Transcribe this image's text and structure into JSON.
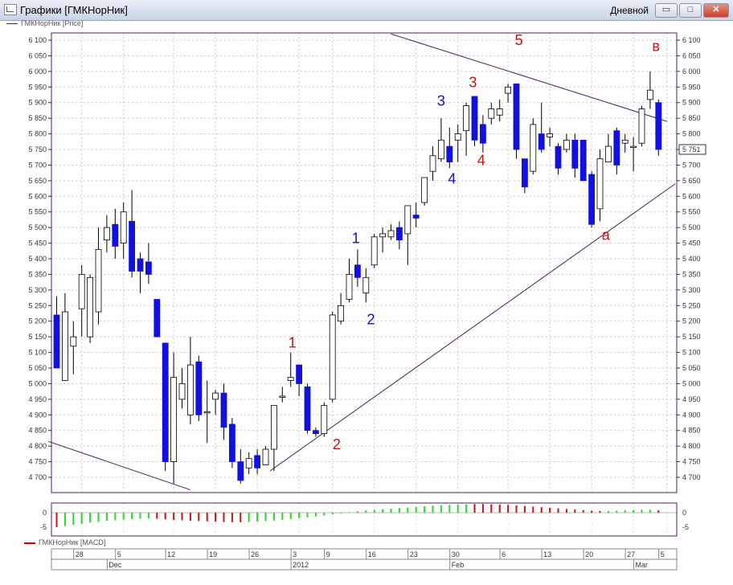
{
  "window": {
    "title": "Графики [ГМКНорНик]",
    "period": "Дневной",
    "buttons": {
      "minimize": "▭",
      "maximize": "□",
      "close": "✕"
    }
  },
  "price_legend": "ГМКНорНик [Price]",
  "macd_legend": "ГМКНорНик [MACD]",
  "last_price": "5 751",
  "colors": {
    "up": "#ffffff",
    "down": "#1010e0",
    "wick": "#000000",
    "trendline": "#4d1f5e",
    "macd_pos": "#22dd22",
    "macd_neg": "#cc1111"
  },
  "chart_data": {
    "type": "candlestick",
    "ylim": [
      4650,
      6125
    ],
    "y_ticks": [
      "4 700",
      "4 750",
      "4 800",
      "4 850",
      "4 900",
      "4 950",
      "5 000",
      "5 050",
      "5 100",
      "5 150",
      "5 200",
      "5 250",
      "5 300",
      "5 350",
      "5 400",
      "5 450",
      "5 500",
      "5 550",
      "5 600",
      "5 650",
      "5 700",
      "5 750",
      "5 800",
      "5 850",
      "5 900",
      "5 950",
      "6 000",
      "6 050",
      "6 100"
    ],
    "candles": [
      [
        5220,
        5050,
        5280,
        5050
      ],
      [
        5010,
        5230,
        5290,
        5010
      ],
      [
        5120,
        5150,
        5200,
        5030
      ],
      [
        5240,
        5350,
        5380,
        5150
      ],
      [
        5150,
        5340,
        5350,
        5130
      ],
      [
        5230,
        5430,
        5500,
        5190
      ],
      [
        5460,
        5500,
        5540,
        5420
      ],
      [
        5510,
        5440,
        5560,
        5400
      ],
      [
        5450,
        5550,
        5580,
        5400
      ],
      [
        5520,
        5360,
        5620,
        5340
      ],
      [
        5400,
        5360,
        5420,
        5290
      ],
      [
        5390,
        5350,
        5450,
        5320
      ],
      [
        5270,
        5150,
        5270,
        5150
      ],
      [
        5130,
        4750,
        5130,
        4720
      ],
      [
        4750,
        5020,
        5100,
        4680
      ],
      [
        4950,
        5000,
        5050,
        4920
      ],
      [
        4900,
        5060,
        5150,
        4870
      ],
      [
        5070,
        4900,
        5090,
        4880
      ],
      [
        4910,
        4910,
        5010,
        4810
      ],
      [
        4950,
        4970,
        4980,
        4900
      ],
      [
        4970,
        4860,
        5000,
        4820
      ],
      [
        4870,
        4750,
        4890,
        4730
      ],
      [
        4750,
        4690,
        4790,
        4680
      ],
      [
        4730,
        4760,
        4780,
        4710
      ],
      [
        4770,
        4730,
        4790,
        4710
      ],
      [
        4740,
        4790,
        4800,
        4740
      ],
      [
        4790,
        4930,
        4930,
        4720
      ],
      [
        4960,
        4960,
        4990,
        4940
      ],
      [
        5010,
        5020,
        5100,
        4990
      ],
      [
        5060,
        5000,
        5060,
        4960
      ],
      [
        4990,
        4850,
        5000,
        4840
      ],
      [
        4850,
        4840,
        4860,
        4830
      ],
      [
        4840,
        4930,
        4940,
        4830
      ],
      [
        4950,
        5220,
        5230,
        4940
      ],
      [
        5200,
        5250,
        5290,
        5190
      ],
      [
        5270,
        5350,
        5400,
        5260
      ],
      [
        5380,
        5340,
        5430,
        5310
      ],
      [
        5290,
        5340,
        5370,
        5260
      ],
      [
        5380,
        5470,
        5480,
        5370
      ],
      [
        5470,
        5480,
        5500,
        5420
      ],
      [
        5470,
        5490,
        5510,
        5460
      ],
      [
        5500,
        5460,
        5520,
        5430
      ],
      [
        5480,
        5570,
        5570,
        5380
      ],
      [
        5540,
        5530,
        5580,
        5500
      ],
      [
        5580,
        5660,
        5660,
        5570
      ],
      [
        5680,
        5730,
        5760,
        5650
      ],
      [
        5720,
        5780,
        5850,
        5710
      ],
      [
        5760,
        5710,
        5820,
        5690
      ],
      [
        5780,
        5800,
        5830,
        5710
      ],
      [
        5810,
        5890,
        5900,
        5730
      ],
      [
        5920,
        5780,
        5920,
        5760
      ],
      [
        5830,
        5770,
        5860,
        5740
      ],
      [
        5850,
        5880,
        5900,
        5830
      ],
      [
        5860,
        5880,
        5910,
        5840
      ],
      [
        5930,
        5950,
        5960,
        5900
      ],
      [
        5960,
        5750,
        5960,
        5720
      ],
      [
        5720,
        5630,
        5720,
        5610
      ],
      [
        5680,
        5830,
        5850,
        5670
      ],
      [
        5800,
        5750,
        5900,
        5740
      ],
      [
        5790,
        5800,
        5820,
        5760
      ],
      [
        5760,
        5690,
        5770,
        5670
      ],
      [
        5750,
        5780,
        5800,
        5740
      ],
      [
        5780,
        5690,
        5800,
        5660
      ],
      [
        5780,
        5650,
        5780,
        5650
      ],
      [
        5670,
        5510,
        5680,
        5500
      ],
      [
        5560,
        5720,
        5750,
        5520
      ],
      [
        5710,
        5760,
        5800,
        5710
      ],
      [
        5810,
        5700,
        5820,
        5670
      ],
      [
        5770,
        5780,
        5800,
        5740
      ],
      [
        5760,
        5760,
        5790,
        5680
      ],
      [
        5770,
        5880,
        5890,
        5760
      ],
      [
        5910,
        5940,
        6000,
        5880
      ],
      [
        5900,
        5750,
        5910,
        5730
      ]
    ],
    "x_ticks": [
      "28",
      "5",
      "12",
      "19",
      "26",
      "3",
      "9",
      "16",
      "23",
      "30",
      "6",
      "13",
      "20",
      "27",
      "5"
    ],
    "x_tick_index": [
      3,
      8,
      14,
      19,
      24,
      29,
      33,
      38,
      43,
      48,
      54,
      59,
      64,
      69,
      73
    ],
    "months": [
      {
        "label": "Dec",
        "index": 7
      },
      {
        "label": "2012",
        "index": 29
      },
      {
        "label": "Feb",
        "index": 48
      },
      {
        "label": "Mar",
        "index": 70
      }
    ],
    "trendlines": [
      {
        "from": [
          -1,
          4815
        ],
        "to": [
          16,
          4660
        ]
      },
      {
        "from": [
          25.5,
          4720
        ],
        "to": [
          74,
          5640
        ]
      },
      {
        "from": [
          40,
          6120
        ],
        "to": [
          73,
          5840
        ]
      }
    ],
    "wave_labels": [
      {
        "text": "1",
        "index": 28.2,
        "value": 5115,
        "color": "#d01010"
      },
      {
        "text": "2",
        "index": 33.5,
        "value": 4790,
        "color": "#d01010"
      },
      {
        "text": "1",
        "index": 35.8,
        "value": 5450,
        "color": "#1010c0"
      },
      {
        "text": "2",
        "index": 37.6,
        "value": 5190,
        "color": "#1010c0"
      },
      {
        "text": "3",
        "index": 46.0,
        "value": 5890,
        "color": "#1010c0"
      },
      {
        "text": "4",
        "index": 47.3,
        "value": 5640,
        "color": "#1010c0"
      },
      {
        "text": "3",
        "index": 49.8,
        "value": 5950,
        "color": "#d01010"
      },
      {
        "text": "4",
        "index": 50.8,
        "value": 5700,
        "color": "#d01010"
      },
      {
        "text": "5",
        "index": 55.3,
        "value": 6085,
        "color": "#d01010"
      },
      {
        "text": "a",
        "index": 65.7,
        "value": 5460,
        "color": "#d01010"
      },
      {
        "text": "в",
        "index": 71.7,
        "value": 6065,
        "color": "#d01010"
      }
    ],
    "macd": {
      "axis_labels": [
        "0",
        "-5"
      ],
      "values": [
        -5,
        -4.6,
        -4.2,
        -3.8,
        -3.4,
        -3.1,
        -2.8,
        -2.6,
        -2.4,
        -2.2,
        -2.1,
        -2.0,
        -2.1,
        -2.3,
        -2.5,
        -2.6,
        -2.8,
        -2.9,
        -3.0,
        -3.1,
        -3.2,
        -3.3,
        -3.3,
        -3.2,
        -3.1,
        -2.9,
        -2.7,
        -2.5,
        -2.2,
        -1.9,
        -1.6,
        -1.3,
        -1.0,
        -0.6,
        -0.3,
        0.2,
        0.5,
        0.8,
        1.0,
        1.2,
        1.4,
        1.6,
        1.8,
        2.0,
        2.2,
        2.4,
        2.6,
        2.7,
        2.8,
        2.9,
        3.0,
        3.0,
        2.9,
        2.8,
        2.7,
        2.5,
        2.3,
        2.1,
        1.9,
        1.7,
        1.5,
        1.3,
        1.1,
        0.9,
        0.7,
        0.6,
        0.6,
        0.7,
        0.8,
        0.9,
        1.0,
        1.0,
        0.8
      ],
      "colors": [
        "r",
        "g",
        "g",
        "g",
        "g",
        "g",
        "g",
        "g",
        "g",
        "g",
        "g",
        "g",
        "r",
        "r",
        "r",
        "r",
        "r",
        "r",
        "r",
        "r",
        "r",
        "r",
        "r",
        "g",
        "g",
        "g",
        "g",
        "g",
        "g",
        "g",
        "g",
        "g",
        "g",
        "g",
        "g",
        "g",
        "g",
        "g",
        "g",
        "g",
        "g",
        "g",
        "g",
        "g",
        "g",
        "g",
        "g",
        "g",
        "g",
        "g",
        "r",
        "r",
        "r",
        "r",
        "r",
        "r",
        "r",
        "r",
        "r",
        "r",
        "r",
        "r",
        "r",
        "r",
        "r",
        "r",
        "g",
        "g",
        "g",
        "g",
        "g",
        "g",
        "r"
      ]
    }
  }
}
